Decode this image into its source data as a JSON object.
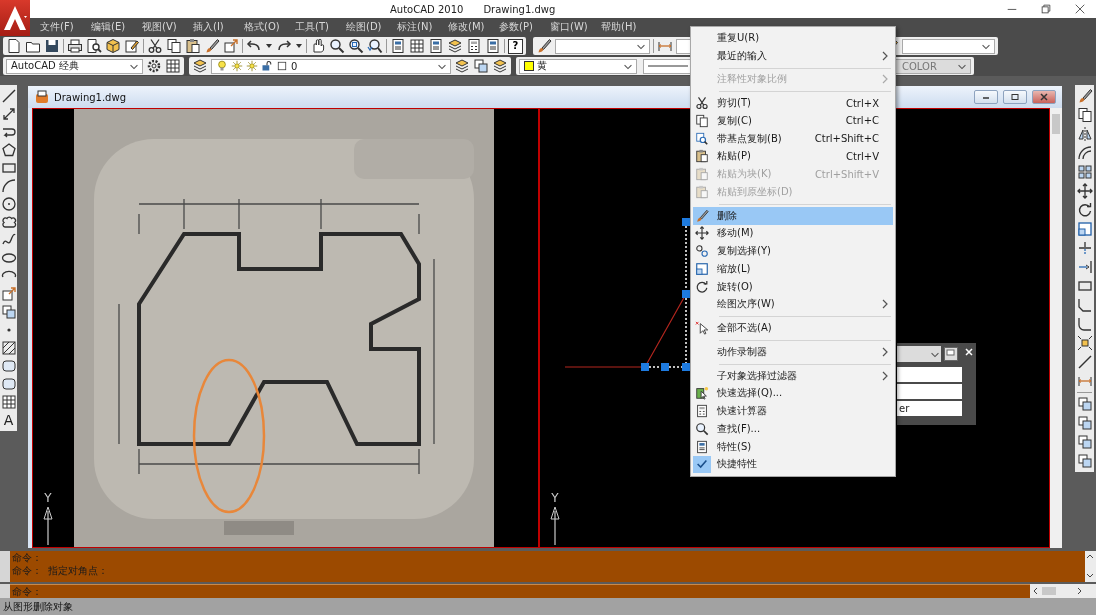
{
  "app": {
    "title": "AutoCAD 2010",
    "document": "Drawing1.dwg"
  },
  "menu_bar": [
    "文件(F)",
    "编辑(E)",
    "视图(V)",
    "插入(I)",
    "格式(O)",
    "工具(T)",
    "绘图(D)",
    "标注(N)",
    "修改(M)",
    "参数(P)",
    "窗口(W)",
    "帮助(H)"
  ],
  "toolbar": {
    "help_key": "?"
  },
  "properties_bar": {
    "workspace": "AutoCAD 经典",
    "layer": "0",
    "color_setting": "黄",
    "plot_style": "COLOR"
  },
  "left_toolbar": {
    "text_tool": "A"
  },
  "drawing_window": {
    "title": "Drawing1.dwg",
    "viewports": [
      {
        "kind": "picture",
        "axis_label": "Y"
      },
      {
        "kind": "model",
        "axis_label": "Y"
      }
    ]
  },
  "quick_properties": {
    "visible_text": "er"
  },
  "context_menu": [
    {
      "kind": "item",
      "label": "重复U(R)",
      "submenu": false,
      "disabled": false,
      "selected": false,
      "checked": false
    },
    {
      "kind": "item",
      "label": "最近的输入",
      "submenu": true,
      "disabled": false,
      "selected": false,
      "checked": false
    },
    {
      "kind": "separator"
    },
    {
      "kind": "item",
      "label": "注释性对象比例",
      "submenu": true,
      "disabled": true,
      "selected": false,
      "checked": false
    },
    {
      "kind": "separator"
    },
    {
      "kind": "item",
      "label": "剪切(T)",
      "shortcut": "Ctrl+X",
      "submenu": false,
      "disabled": false,
      "selected": false,
      "checked": false
    },
    {
      "kind": "item",
      "label": "复制(C)",
      "shortcut": "Ctrl+C",
      "submenu": false,
      "disabled": false,
      "selected": false,
      "checked": false
    },
    {
      "kind": "item",
      "label": "带基点复制(B)",
      "shortcut": "Ctrl+Shift+C",
      "submenu": false,
      "disabled": false,
      "selected": false,
      "checked": false
    },
    {
      "kind": "item",
      "label": "粘贴(P)",
      "shortcut": "Ctrl+V",
      "submenu": false,
      "disabled": false,
      "selected": false,
      "checked": false
    },
    {
      "kind": "item",
      "label": "粘贴为块(K)",
      "shortcut": "Ctrl+Shift+V",
      "submenu": false,
      "disabled": true,
      "selected": false,
      "checked": false
    },
    {
      "kind": "item",
      "label": "粘贴到原坐标(D)",
      "submenu": false,
      "disabled": true,
      "selected": false,
      "checked": false
    },
    {
      "kind": "separator"
    },
    {
      "kind": "item",
      "label": "删除",
      "submenu": false,
      "disabled": false,
      "selected": true,
      "checked": false
    },
    {
      "kind": "item",
      "label": "移动(M)",
      "submenu": false,
      "disabled": false,
      "selected": false,
      "checked": false
    },
    {
      "kind": "item",
      "label": "复制选择(Y)",
      "submenu": false,
      "disabled": false,
      "selected": false,
      "checked": false
    },
    {
      "kind": "item",
      "label": "缩放(L)",
      "submenu": false,
      "disabled": false,
      "selected": false,
      "checked": false
    },
    {
      "kind": "item",
      "label": "旋转(O)",
      "submenu": false,
      "disabled": false,
      "selected": false,
      "checked": false
    },
    {
      "kind": "item",
      "label": "绘图次序(W)",
      "submenu": true,
      "disabled": false,
      "selected": false,
      "checked": false
    },
    {
      "kind": "separator"
    },
    {
      "kind": "item",
      "label": "全部不选(A)",
      "submenu": false,
      "disabled": false,
      "selected": false,
      "checked": false
    },
    {
      "kind": "separator"
    },
    {
      "kind": "item",
      "label": "动作录制器",
      "submenu": true,
      "disabled": false,
      "selected": false,
      "checked": false
    },
    {
      "kind": "separator"
    },
    {
      "kind": "item",
      "label": "子对象选择过滤器",
      "submenu": true,
      "disabled": false,
      "selected": false,
      "checked": false
    },
    {
      "kind": "item",
      "label": "快速选择(Q)...",
      "submenu": false,
      "disabled": false,
      "selected": false,
      "checked": false
    },
    {
      "kind": "item",
      "label": "快速计算器",
      "submenu": false,
      "disabled": false,
      "selected": false,
      "checked": false
    },
    {
      "kind": "item",
      "label": "查找(F)...",
      "submenu": false,
      "disabled": false,
      "selected": false,
      "checked": false
    },
    {
      "kind": "item",
      "label": "特性(S)",
      "submenu": false,
      "disabled": false,
      "selected": false,
      "checked": false
    },
    {
      "kind": "item",
      "label": "快捷特性",
      "submenu": false,
      "disabled": false,
      "selected": false,
      "checked": true
    }
  ],
  "command_line": {
    "history": [
      "命令：",
      "命令： 指定对角点："
    ],
    "prompt": "命令："
  },
  "status_bar": {
    "message": "从图形删除对象"
  }
}
